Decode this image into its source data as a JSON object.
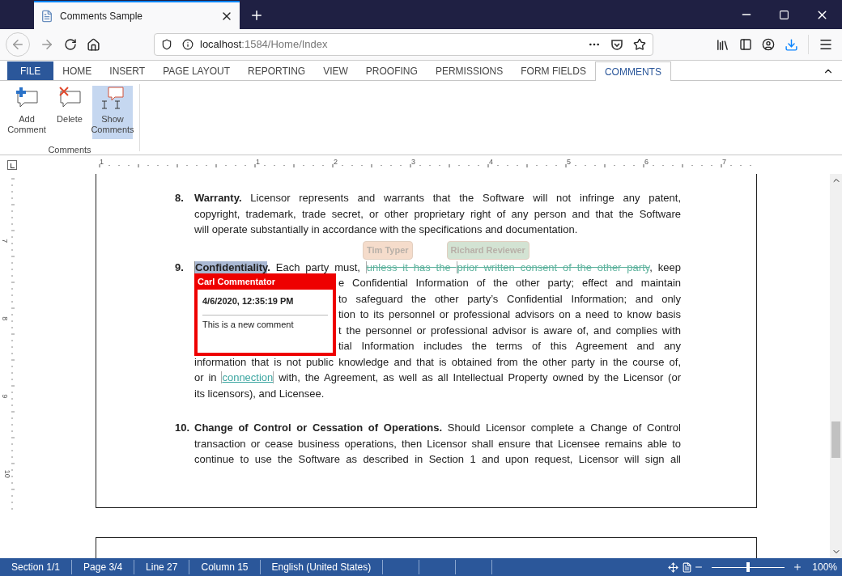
{
  "browser": {
    "tab_title": "Comments Sample",
    "url_host": "localhost",
    "url_rest": ":1584/Home/Index"
  },
  "ribbon": {
    "tabs": [
      {
        "label": "FILE",
        "kind": "file",
        "selected": false
      },
      {
        "label": "HOME",
        "kind": "tab",
        "selected": false
      },
      {
        "label": "INSERT",
        "kind": "tab",
        "selected": false
      },
      {
        "label": "PAGE LAYOUT",
        "kind": "tab",
        "selected": false
      },
      {
        "label": "REPORTING",
        "kind": "tab",
        "selected": false
      },
      {
        "label": "VIEW",
        "kind": "tab",
        "selected": false
      },
      {
        "label": "PROOFING",
        "kind": "tab",
        "selected": false
      },
      {
        "label": "PERMISSIONS",
        "kind": "tab",
        "selected": false
      },
      {
        "label": "FORM FIELDS",
        "kind": "tab",
        "selected": false
      },
      {
        "label": "COMMENTS",
        "kind": "tab",
        "selected": true
      }
    ],
    "buttons": [
      {
        "label": "Add Comment",
        "kind": "add",
        "selected": false
      },
      {
        "label": "Delete",
        "kind": "delete",
        "selected": false
      },
      {
        "label": "Show Comments",
        "kind": "show",
        "selected": true
      }
    ],
    "group_label": "Comments"
  },
  "rulers": {
    "horizontal": [
      "1",
      "1",
      "2",
      "3",
      "4",
      "5",
      "6",
      "7"
    ],
    "vertical": [
      "7",
      "8",
      "9",
      "10"
    ]
  },
  "document": {
    "paragraphs": [
      {
        "number": "8.",
        "lines": [
          {
            "covered": false,
            "segments": [
              {
                "kind": "bold",
                "text": "Warranty."
              },
              {
                "kind": "plain",
                "text": " Licensor represents and warrants that the Software will not infringe any patent,"
              }
            ]
          },
          {
            "covered": false,
            "segments": [
              {
                "kind": "plain",
                "text": "copyright, trademark, trade secret, or other proprietary right of any person and that the Software"
              }
            ]
          },
          {
            "covered": false,
            "last": true,
            "segments": [
              {
                "kind": "plain",
                "text": "will operate substantially in accordance with the specifications and documentation."
              }
            ]
          }
        ]
      },
      {
        "number": "9.",
        "tags": [
          {
            "author": "Tim Typer",
            "color": "#f5dccb"
          },
          {
            "author": "Richard Reviewer",
            "color": "#d3e3d3"
          }
        ],
        "lines": [
          {
            "covered": false,
            "segments": [
              {
                "kind": "commented",
                "text": "Confidentiality"
              },
              {
                "kind": "bold",
                "text": "."
              },
              {
                "kind": "plain",
                "text": " Each party must, "
              },
              {
                "kind": "deleted",
                "text": "unless it has the "
              },
              {
                "kind": "deleted",
                "text": "prior written consent of the other party"
              },
              {
                "kind": "plain",
                "text": ", keep"
              }
            ]
          },
          {
            "covered": true,
            "segments": [
              {
                "kind": "plain",
                "text": "e Confidential Information of the other party; effect and maintain"
              }
            ]
          },
          {
            "covered": true,
            "segments": [
              {
                "kind": "plain",
                "text": "to safeguard the other party’s Confidential Information; and only"
              }
            ]
          },
          {
            "covered": true,
            "segments": [
              {
                "kind": "plain",
                "text": "tion to its personnel or professional advisors on a need to know basis"
              }
            ]
          },
          {
            "covered": true,
            "segments": [
              {
                "kind": "plain",
                "text": "t the personnel or professional advisor is aware of, and complies with"
              }
            ]
          },
          {
            "covered": true,
            "segments": [
              {
                "kind": "plain",
                "text": "tial Information includes the terms of this Agreement and any"
              }
            ]
          },
          {
            "covered": false,
            "segments": [
              {
                "kind": "plain",
                "text": "information that is not public knowledge and that is obtained from the other party in the course of,"
              }
            ]
          },
          {
            "covered": false,
            "segments": [
              {
                "kind": "plain",
                "text": "or in "
              },
              {
                "kind": "inserted",
                "text": "connection"
              },
              {
                "kind": "plain",
                "text": " with, the Agreement, as well as all Intellectual Property owned by the Licensor (or"
              }
            ]
          },
          {
            "covered": false,
            "last": true,
            "segments": [
              {
                "kind": "plain",
                "text": "its licensors), and Licensee."
              }
            ]
          }
        ]
      },
      {
        "number": "10.",
        "lines": [
          {
            "covered": false,
            "segments": [
              {
                "kind": "bold",
                "text": "Change of Control or Cessation of Operations."
              },
              {
                "kind": "plain",
                "text": " Should Licensor complete a Change of Control"
              }
            ]
          },
          {
            "covered": false,
            "segments": [
              {
                "kind": "plain",
                "text": "transaction or cease business operations, then Licensor shall ensure that Licensee remains able to"
              }
            ]
          },
          {
            "covered": false,
            "segments": [
              {
                "kind": "plain",
                "text": "continue to use the Software as described in Section 1 and upon request, Licensor will sign all"
              }
            ]
          }
        ]
      }
    ],
    "comment": {
      "author": "Carl Commentator",
      "date": "4/6/2020, 12:35:19 PM",
      "text": "This is a new comment"
    }
  },
  "status_bar": {
    "items": [
      "Section 1/1",
      "Page 3/4",
      "Line 27",
      "Column 15",
      "English (United States)"
    ],
    "zoom": {
      "level": 0.5,
      "reading": "100%"
    }
  }
}
